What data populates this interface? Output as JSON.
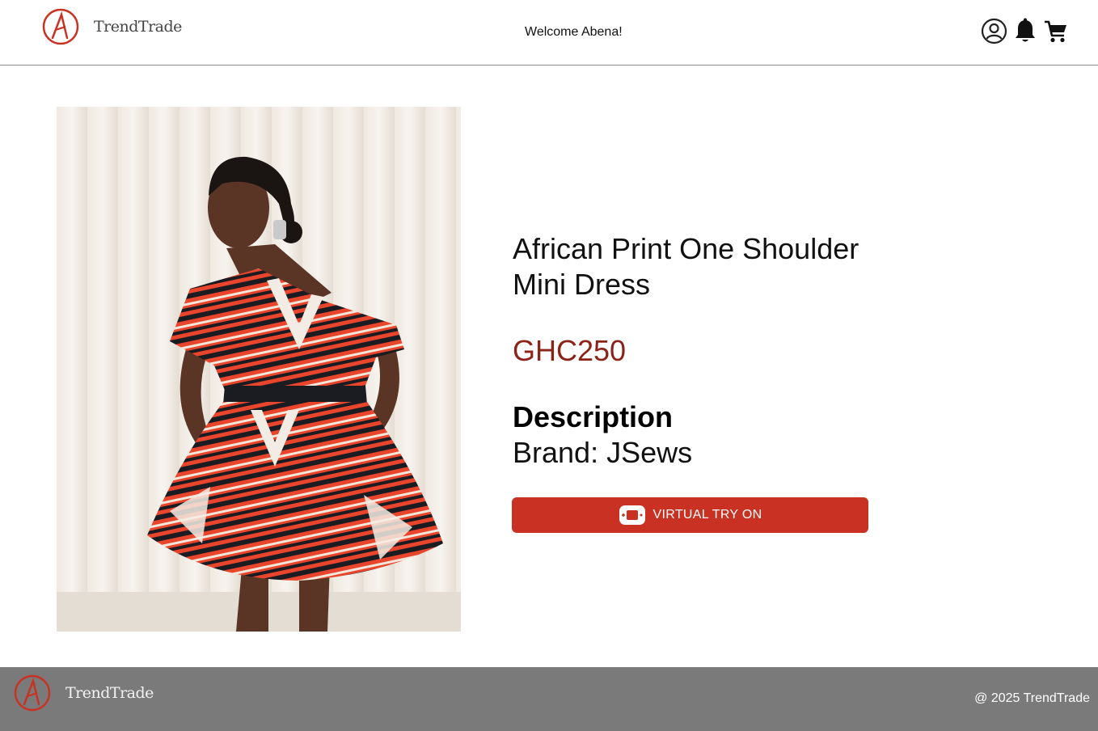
{
  "header": {
    "logo_text": "TrendTrade",
    "welcome": "Welcome Abena!",
    "icons": [
      "user-circle-icon",
      "bell-icon",
      "cart-icon"
    ]
  },
  "product": {
    "title": "African Print One Shoulder Mini Dress",
    "price": "GHC250",
    "description_heading": "Description",
    "brand": "Brand: JSews",
    "tryon_label": "VIRTUAL TRY ON",
    "tryon_icon": "vr-headset-icon"
  },
  "footer": {
    "logo_text": "TrendTrade",
    "copyright": "@ 2025 TrendTrade"
  },
  "colors": {
    "accent": "#c93222",
    "price": "#8b2318",
    "footer_bg": "#7a7a7a"
  }
}
